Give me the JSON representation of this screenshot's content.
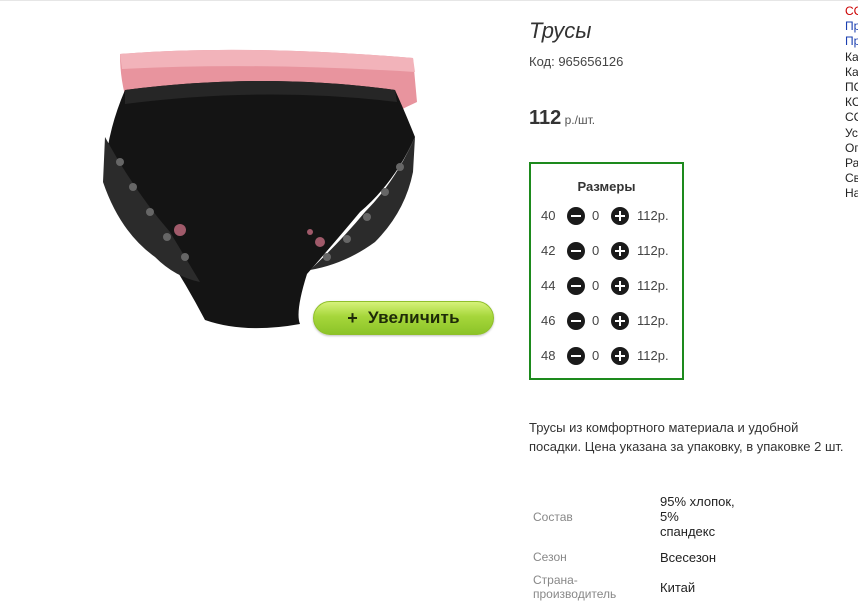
{
  "product": {
    "title": "Трусы",
    "code": "Код: 965656126",
    "price_value": "112",
    "price_unit": " р./шт.",
    "zoom_icon": "+",
    "zoom_label": "Увеличить",
    "image_icon": "underwear-photo"
  },
  "sizes": {
    "heading": "Размеры",
    "rows": [
      {
        "size": "40",
        "qty": "0",
        "price": "112р."
      },
      {
        "size": "42",
        "qty": "0",
        "price": "112р."
      },
      {
        "size": "44",
        "qty": "0",
        "price": "112р."
      },
      {
        "size": "46",
        "qty": "0",
        "price": "112р."
      },
      {
        "size": "48",
        "qty": "0",
        "price": "112р."
      }
    ]
  },
  "description": "Трусы из комфортного материала и удобной посадки. Цена указана за упаковку, в упаковке 2 шт.",
  "specs": {
    "composition_label": "Состав",
    "composition_lines": [
      "95% хлопок,",
      "5%",
      "спандекс"
    ],
    "season_label": "Сезон",
    "season_value": "Всесезон",
    "country_label_lines": [
      "Страна-",
      "производитель"
    ],
    "country_value": "Китай"
  },
  "side_menu": [
    "СС",
    "Пр",
    "Пр",
    "Ка",
    "Ка",
    "ПО",
    "КС",
    "СС",
    "Ус",
    "Оп",
    "Ра",
    "Св",
    "На"
  ],
  "colors": {
    "border_green": "#1d8a1d",
    "button_green": "#a6d63b",
    "link_blue": "#1a3fb0",
    "link_red": "#cc0000"
  }
}
